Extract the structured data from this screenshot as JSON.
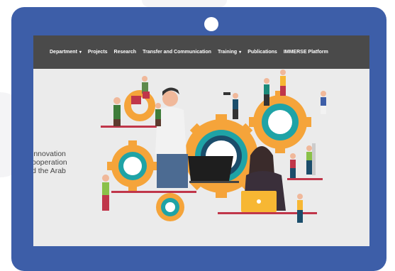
{
  "nav": {
    "items": [
      {
        "label": "Department",
        "dropdown": true
      },
      {
        "label": "Projects",
        "dropdown": false
      },
      {
        "label": "Research",
        "dropdown": false
      },
      {
        "label": "Transfer and Communication",
        "dropdown": false
      },
      {
        "label": "Training",
        "dropdown": true
      },
      {
        "label": "Publications",
        "dropdown": false
      },
      {
        "label": "IMMERSE Platform",
        "dropdown": false
      }
    ],
    "chevron_glyph": "▾"
  },
  "hero": {
    "lines": [
      "innovation",
      "ooperation",
      "d the Arab"
    ]
  },
  "colors": {
    "device": "#3d5ea8",
    "navbar": "#4a4a4a",
    "content_bg": "#ebebeb",
    "gear_orange": "#f5a43a",
    "gear_ring_teal": "#1fa3a6",
    "accent_red": "#c0364a"
  }
}
